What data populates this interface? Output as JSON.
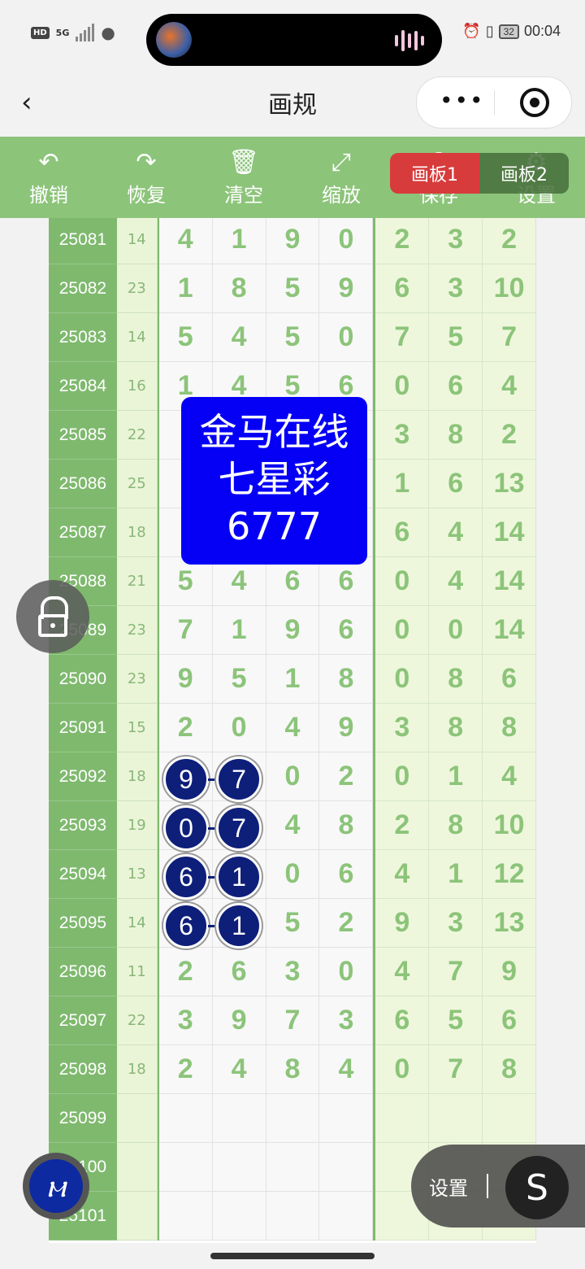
{
  "status": {
    "hd": "HD",
    "net": "5G",
    "battery": "32",
    "time": "00:04"
  },
  "nav": {
    "back_glyph": "‹",
    "title": "画规",
    "more": "•••"
  },
  "toolbar": [
    {
      "icon": "undo-icon",
      "glyph": "↶",
      "label": "撤销"
    },
    {
      "icon": "redo-icon",
      "glyph": "↷",
      "label": "恢复"
    },
    {
      "icon": "trash-icon",
      "glyph": "🗑",
      "label": "清空"
    },
    {
      "icon": "zoom-icon",
      "glyph": "⤢",
      "label": "缩放"
    },
    {
      "icon": "save-icon",
      "glyph": "⬇",
      "label": "保存"
    },
    {
      "icon": "gear-icon",
      "glyph": "⚙",
      "label": "设置"
    }
  ],
  "boards": {
    "board1": "画板1",
    "board2": "画板2"
  },
  "ad": {
    "line1": "金马在线",
    "line2": "七星彩",
    "line3": "6777"
  },
  "rows": [
    {
      "id": "25081",
      "sum": "14",
      "digits": [
        "4",
        "1",
        "9",
        "0"
      ],
      "extra": [
        "2",
        "3",
        "2"
      ]
    },
    {
      "id": "25082",
      "sum": "23",
      "digits": [
        "1",
        "8",
        "5",
        "9"
      ],
      "extra": [
        "6",
        "3",
        "10"
      ]
    },
    {
      "id": "25083",
      "sum": "14",
      "digits": [
        "5",
        "4",
        "5",
        "0"
      ],
      "extra": [
        "7",
        "5",
        "7"
      ]
    },
    {
      "id": "25084",
      "sum": "16",
      "digits": [
        "1",
        "4",
        "5",
        "6"
      ],
      "extra": [
        "0",
        "6",
        "4"
      ]
    },
    {
      "id": "25085",
      "sum": "22",
      "digits": [
        "",
        "",
        "",
        ""
      ],
      "extra": [
        "3",
        "8",
        "2"
      ]
    },
    {
      "id": "25086",
      "sum": "25",
      "digits": [
        "",
        "",
        "",
        ""
      ],
      "extra": [
        "1",
        "6",
        "13"
      ]
    },
    {
      "id": "25087",
      "sum": "18",
      "digits": [
        "",
        "",
        "",
        ""
      ],
      "extra": [
        "6",
        "4",
        "14"
      ]
    },
    {
      "id": "25088",
      "sum": "21",
      "digits": [
        "5",
        "4",
        "6",
        "6"
      ],
      "extra": [
        "0",
        "4",
        "14"
      ]
    },
    {
      "id": "25089",
      "sum": "23",
      "digits": [
        "7",
        "1",
        "9",
        "6"
      ],
      "extra": [
        "0",
        "0",
        "14"
      ]
    },
    {
      "id": "25090",
      "sum": "23",
      "digits": [
        "9",
        "5",
        "1",
        "8"
      ],
      "extra": [
        "0",
        "8",
        "6"
      ]
    },
    {
      "id": "25091",
      "sum": "15",
      "digits": [
        "2",
        "0",
        "4",
        "9"
      ],
      "extra": [
        "3",
        "8",
        "8"
      ]
    },
    {
      "id": "25092",
      "sum": "18",
      "digits": [
        "",
        "",
        "0",
        "2"
      ],
      "extra": [
        "0",
        "1",
        "4"
      ]
    },
    {
      "id": "25093",
      "sum": "19",
      "digits": [
        "",
        "",
        "4",
        "8"
      ],
      "extra": [
        "2",
        "8",
        "10"
      ]
    },
    {
      "id": "25094",
      "sum": "13",
      "digits": [
        "",
        "",
        "0",
        "6"
      ],
      "extra": [
        "4",
        "1",
        "12"
      ]
    },
    {
      "id": "25095",
      "sum": "14",
      "digits": [
        "",
        "",
        "5",
        "2"
      ],
      "extra": [
        "9",
        "3",
        "13"
      ]
    },
    {
      "id": "25096",
      "sum": "11",
      "digits": [
        "2",
        "6",
        "3",
        "0"
      ],
      "extra": [
        "4",
        "7",
        "9"
      ]
    },
    {
      "id": "25097",
      "sum": "22",
      "digits": [
        "3",
        "9",
        "7",
        "3"
      ],
      "extra": [
        "6",
        "5",
        "6"
      ]
    },
    {
      "id": "25098",
      "sum": "18",
      "digits": [
        "2",
        "4",
        "8",
        "4"
      ],
      "extra": [
        "0",
        "7",
        "8"
      ]
    },
    {
      "id": "25099",
      "sum": "",
      "digits": [
        "",
        "",
        "",
        ""
      ],
      "extra": [
        "",
        "",
        ""
      ]
    },
    {
      "id": "25100",
      "sum": "",
      "digits": [
        "",
        "",
        "",
        ""
      ],
      "extra": [
        "",
        "",
        ""
      ]
    },
    {
      "id": "25101",
      "sum": "",
      "digits": [
        "",
        "",
        "",
        ""
      ],
      "extra": [
        "",
        "",
        ""
      ]
    }
  ],
  "marked": [
    {
      "row": 11,
      "a": "9",
      "b": "7"
    },
    {
      "row": 12,
      "a": "0",
      "b": "7"
    },
    {
      "row": 13,
      "a": "6",
      "b": "1"
    },
    {
      "row": 14,
      "a": "6",
      "b": "1"
    }
  ],
  "fab": {
    "settings_label": "设置",
    "s_glyph": "S"
  },
  "colors": {
    "green": "#8cc47a",
    "dark_green": "#7fb96e",
    "ad_blue": "#0500f5",
    "ball_blue": "#0e1f7a",
    "red": "#d83b3b"
  }
}
